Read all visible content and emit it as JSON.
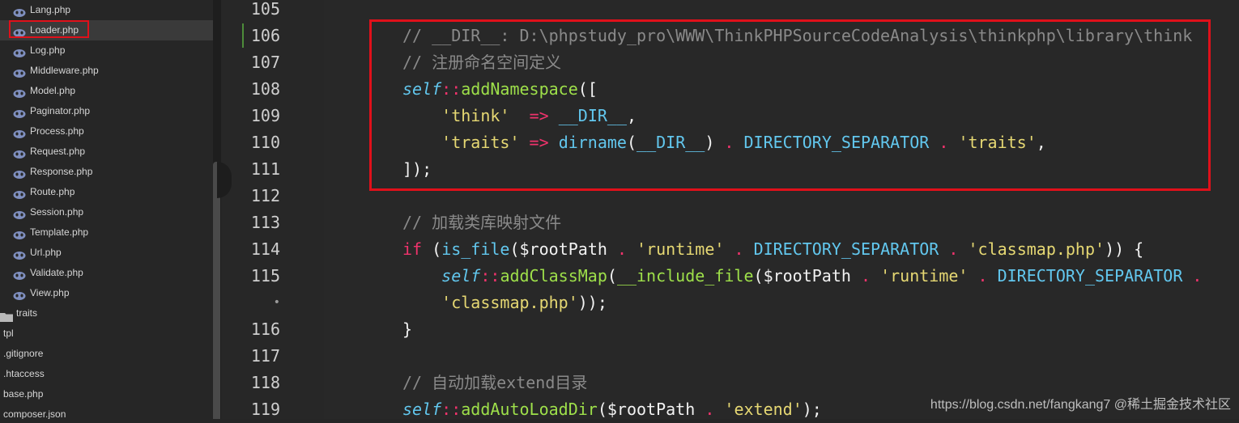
{
  "sidebar": {
    "files": [
      {
        "name": "Lang.php",
        "kind": "php"
      },
      {
        "name": "Loader.php",
        "kind": "php",
        "selected": true
      },
      {
        "name": "Log.php",
        "kind": "php"
      },
      {
        "name": "Middleware.php",
        "kind": "php"
      },
      {
        "name": "Model.php",
        "kind": "php"
      },
      {
        "name": "Paginator.php",
        "kind": "php"
      },
      {
        "name": "Process.php",
        "kind": "php"
      },
      {
        "name": "Request.php",
        "kind": "php"
      },
      {
        "name": "Response.php",
        "kind": "php"
      },
      {
        "name": "Route.php",
        "kind": "php"
      },
      {
        "name": "Session.php",
        "kind": "php"
      },
      {
        "name": "Template.php",
        "kind": "php"
      },
      {
        "name": "Url.php",
        "kind": "php"
      },
      {
        "name": "Validate.php",
        "kind": "php"
      },
      {
        "name": "View.php",
        "kind": "php"
      },
      {
        "name": "traits",
        "kind": "folder"
      },
      {
        "name": "tpl",
        "kind": "plain"
      },
      {
        "name": ".gitignore",
        "kind": "plain"
      },
      {
        "name": ".htaccess",
        "kind": "plain"
      },
      {
        "name": "base.php",
        "kind": "plain"
      },
      {
        "name": "composer.json",
        "kind": "plain"
      }
    ]
  },
  "gutter": {
    "line_numbers": [
      "105",
      "106",
      "107",
      "108",
      "109",
      "110",
      "111",
      "112",
      "113",
      "114",
      "115",
      "•",
      "116",
      "117",
      "118",
      "119"
    ]
  },
  "editor": {
    "lines": [
      [],
      [
        {
          "t": "c",
          "v": "// __DIR__: D:\\phpstudy_pro\\WWW\\ThinkPHPSourceCodeAnalysis\\thinkphp\\library\\think"
        }
      ],
      [
        {
          "t": "c",
          "v": "// 注册命名空间定义"
        }
      ],
      [
        {
          "t": "sf",
          "v": "self"
        },
        {
          "t": "op",
          "v": "::"
        },
        {
          "t": "fn",
          "v": "addNamespace"
        },
        {
          "t": "pn",
          "v": "(["
        }
      ],
      [
        {
          "t": "pn",
          "v": "    "
        },
        {
          "t": "st",
          "v": "'think'"
        },
        {
          "t": "pn",
          "v": "  "
        },
        {
          "t": "op",
          "v": "=>"
        },
        {
          "t": "pn",
          "v": " "
        },
        {
          "t": "cn",
          "v": "__DIR__"
        },
        {
          "t": "pn",
          "v": ","
        }
      ],
      [
        {
          "t": "pn",
          "v": "    "
        },
        {
          "t": "st",
          "v": "'traits'"
        },
        {
          "t": "pn",
          "v": " "
        },
        {
          "t": "op",
          "v": "=>"
        },
        {
          "t": "pn",
          "v": " "
        },
        {
          "t": "cn",
          "v": "dirname"
        },
        {
          "t": "pn",
          "v": "("
        },
        {
          "t": "cn",
          "v": "__DIR__"
        },
        {
          "t": "pn",
          "v": ") "
        },
        {
          "t": "op",
          "v": "."
        },
        {
          "t": "pn",
          "v": " "
        },
        {
          "t": "cn",
          "v": "DIRECTORY_SEPARATOR"
        },
        {
          "t": "pn",
          "v": " "
        },
        {
          "t": "op",
          "v": "."
        },
        {
          "t": "pn",
          "v": " "
        },
        {
          "t": "st",
          "v": "'traits'"
        },
        {
          "t": "pn",
          "v": ","
        }
      ],
      [
        {
          "t": "pn",
          "v": "]);"
        }
      ],
      [],
      [
        {
          "t": "c",
          "v": "// 加载类库映射文件"
        }
      ],
      [
        {
          "t": "kw",
          "v": "if"
        },
        {
          "t": "pn",
          "v": " ("
        },
        {
          "t": "cn",
          "v": "is_file"
        },
        {
          "t": "pn",
          "v": "("
        },
        {
          "t": "vr",
          "v": "$rootPath"
        },
        {
          "t": "pn",
          "v": " "
        },
        {
          "t": "op",
          "v": "."
        },
        {
          "t": "pn",
          "v": " "
        },
        {
          "t": "st",
          "v": "'runtime'"
        },
        {
          "t": "pn",
          "v": " "
        },
        {
          "t": "op",
          "v": "."
        },
        {
          "t": "pn",
          "v": " "
        },
        {
          "t": "cn",
          "v": "DIRECTORY_SEPARATOR"
        },
        {
          "t": "pn",
          "v": " "
        },
        {
          "t": "op",
          "v": "."
        },
        {
          "t": "pn",
          "v": " "
        },
        {
          "t": "st",
          "v": "'classmap.php'"
        },
        {
          "t": "pn",
          "v": ")) {"
        }
      ],
      [
        {
          "t": "pn",
          "v": "    "
        },
        {
          "t": "sf",
          "v": "self"
        },
        {
          "t": "op",
          "v": "::"
        },
        {
          "t": "fn",
          "v": "addClassMap"
        },
        {
          "t": "pn",
          "v": "("
        },
        {
          "t": "fn",
          "v": "__include_file"
        },
        {
          "t": "pn",
          "v": "("
        },
        {
          "t": "vr",
          "v": "$rootPath"
        },
        {
          "t": "pn",
          "v": " "
        },
        {
          "t": "op",
          "v": "."
        },
        {
          "t": "pn",
          "v": " "
        },
        {
          "t": "st",
          "v": "'runtime'"
        },
        {
          "t": "pn",
          "v": " "
        },
        {
          "t": "op",
          "v": "."
        },
        {
          "t": "pn",
          "v": " "
        },
        {
          "t": "cn",
          "v": "DIRECTORY_SEPARATOR"
        },
        {
          "t": "pn",
          "v": " "
        },
        {
          "t": "op",
          "v": "."
        }
      ],
      [
        {
          "t": "pn",
          "v": "    "
        },
        {
          "t": "st",
          "v": "'classmap.php'"
        },
        {
          "t": "pn",
          "v": "));"
        }
      ],
      [
        {
          "t": "pn",
          "v": "}"
        }
      ],
      [],
      [
        {
          "t": "c",
          "v": "// 自动加载extend目录"
        }
      ],
      [
        {
          "t": "sf",
          "v": "self"
        },
        {
          "t": "op",
          "v": "::"
        },
        {
          "t": "fn",
          "v": "addAutoLoadDir"
        },
        {
          "t": "pn",
          "v": "("
        },
        {
          "t": "vr",
          "v": "$rootPath"
        },
        {
          "t": "pn",
          "v": " "
        },
        {
          "t": "op",
          "v": "."
        },
        {
          "t": "pn",
          "v": " "
        },
        {
          "t": "st",
          "v": "'extend'"
        },
        {
          "t": "pn",
          "v": ");"
        }
      ]
    ]
  },
  "watermark": "https://blog.csdn.net/fangkang7 @稀土掘金技术社区",
  "colors": {
    "highlight_box": "#e0101a",
    "comment": "#8a8a8a",
    "keyword": "#f0336c",
    "function": "#9ee04a",
    "string": "#e6d873",
    "constant": "#62c7ee"
  }
}
